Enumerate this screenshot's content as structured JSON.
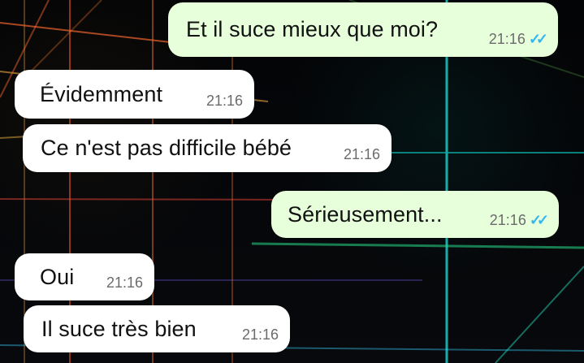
{
  "messages": [
    {
      "text": "Et il suce mieux que moi?",
      "time": "21:16",
      "status": "double-check-icon"
    },
    {
      "text": "Évidemment",
      "time": "21:16"
    },
    {
      "text": "Ce n'est pas difficile bébé",
      "time": "21:16"
    },
    {
      "text": "Sérieusement...",
      "time": "21:16",
      "status": "double-check-icon"
    },
    {
      "text": "Oui",
      "time": "21:16"
    },
    {
      "text": "Il suce très bien",
      "time": "21:16"
    }
  ],
  "colors": {
    "incoming_bubble": "#ffffff",
    "outgoing_bubble": "#e7ffdb",
    "read_ticks": "#34b7f1",
    "background": "#050608"
  }
}
